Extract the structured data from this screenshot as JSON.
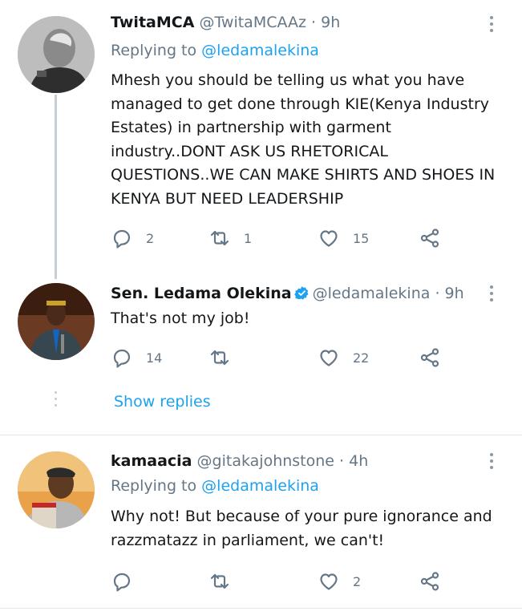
{
  "tweets": [
    {
      "name": "TwitaMCA",
      "handle": "@TwitaMCAAz",
      "time": "· 9h",
      "replying_prefix": "Replying to",
      "replying_to": "@ledamalekina",
      "text": "Mhesh you should be telling us what you have managed to get done through KIE(Kenya Industry Estates) in partnership with garment industry..DONT ASK US RHETORICAL QUESTIONS..WE CAN MAKE SHIRTS AND SHOES IN KENYA BUT NEED LEADERSHIP",
      "replies": "2",
      "retweets": "1",
      "likes": "15"
    },
    {
      "name": "Sen. Ledama Olekina",
      "verified": true,
      "handle": "@ledamalekina",
      "time": "· 9h",
      "text": "That's not my job!",
      "replies": "14",
      "retweets": "",
      "likes": "22"
    },
    {
      "name": "kamaacia",
      "handle": "@gitakajohnstone",
      "time": "· 4h",
      "replying_prefix": "Replying to",
      "replying_to": "@ledamalekina",
      "text": "Why not! But because of your pure ignorance and razzmatazz in parliament, we can't!",
      "replies": "",
      "retweets": "",
      "likes": "2"
    }
  ],
  "thread": {
    "show_replies": "Show replies"
  },
  "icons": {
    "reply": "reply-icon",
    "retweet": "retweet-icon",
    "like": "heart-icon",
    "share": "share-icon",
    "more": "more-options-icon",
    "verified": "verified-badge-icon"
  },
  "colors": {
    "accent": "#1da1f2",
    "text": "#14171a",
    "secondary": "#657786",
    "icon": "#657786",
    "thread_line": "#c4cfd6"
  }
}
